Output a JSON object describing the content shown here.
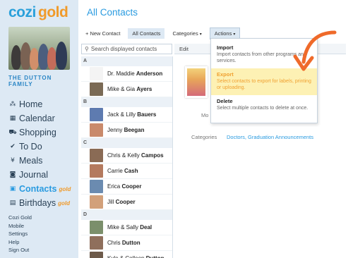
{
  "logo": {
    "left_text": "cozi",
    "right_text": "gold"
  },
  "family": {
    "name": "THE DUTTON FAMILY"
  },
  "nav": {
    "items": [
      {
        "icon": "family-icon",
        "glyph": "⁂",
        "label": "Home"
      },
      {
        "icon": "calendar-icon",
        "glyph": "▦",
        "label": "Calendar"
      },
      {
        "icon": "cart-icon",
        "glyph": "⛟",
        "label": "Shopping"
      },
      {
        "icon": "check-icon",
        "glyph": "✔",
        "label": "To Do"
      },
      {
        "icon": "utensils-icon",
        "glyph": "¥",
        "label": "Meals"
      },
      {
        "icon": "camera-icon",
        "glyph": "◙",
        "label": "Journal"
      },
      {
        "icon": "contacts-icon",
        "glyph": "▣",
        "label": "Contacts",
        "badge": "gold",
        "active": true
      },
      {
        "icon": "gift-icon",
        "glyph": "▤",
        "label": "Birthdays",
        "badge": "gold"
      }
    ]
  },
  "footer_links": [
    "Cozi Gold",
    "Mobile",
    "Settings",
    "Help",
    "Sign Out"
  ],
  "page": {
    "title": "All Contacts"
  },
  "toolbar": {
    "new_contact": "+ New Contact",
    "all_contacts": "All Contacts",
    "categories": "Categories",
    "actions": "Actions"
  },
  "search": {
    "placeholder": "Search displayed contacts"
  },
  "contacts": {
    "groups": [
      {
        "letter": "A",
        "rows": [
          {
            "first": "Dr. Maddie ",
            "last": "Anderson",
            "color": "#f4f4f4"
          },
          {
            "first": "Mike & Gia ",
            "last": "Ayers",
            "color": "#7a6a55"
          }
        ]
      },
      {
        "letter": "B",
        "rows": [
          {
            "first": "Jack & Lilly ",
            "last": "Bauers",
            "color": "#5e7bb0"
          },
          {
            "first": "Jenny ",
            "last": "Beegan",
            "color": "#c98a6b"
          }
        ]
      },
      {
        "letter": "C",
        "rows": [
          {
            "first": "Chris & Kelly ",
            "last": "Campos",
            "color": "#8a6b55"
          },
          {
            "first": "Carrie ",
            "last": "Cash",
            "color": "#b47a5e"
          },
          {
            "first": "Erica ",
            "last": "Cooper",
            "color": "#6b8bb0"
          },
          {
            "first": "Jill ",
            "last": "Cooper",
            "color": "#d2a07a"
          }
        ]
      },
      {
        "letter": "D",
        "rows": [
          {
            "first": "Mike & Sally ",
            "last": "Deal",
            "color": "#7b8f6b"
          },
          {
            "first": "Chris ",
            "last": "Dutton",
            "color": "#8f6f5c"
          },
          {
            "first": "Kyle & Colleen ",
            "last": "Dutton",
            "color": "#6d5a4a"
          }
        ]
      }
    ]
  },
  "detail": {
    "edit_label": "Edit",
    "mobile_label": "Mo",
    "categories_label": "Categories",
    "categories_values": [
      "Doctors",
      "Graduation Announcements"
    ]
  },
  "actions_menu": {
    "items": [
      {
        "title": "Import",
        "desc": "Import contacts from other programs and services."
      },
      {
        "title": "Export",
        "desc": "Select contacts to export for labels, printing or uploading.",
        "highlight": true
      },
      {
        "title": "Delete",
        "desc": "Select multiple contacts to delete at once."
      }
    ]
  },
  "colors": {
    "accent": "#2a9be0",
    "gold": "#f09a2a",
    "sidebar_bg": "#dde9f4",
    "highlight_bg": "#fdf1b4",
    "arrow": "#ef6a2a"
  }
}
